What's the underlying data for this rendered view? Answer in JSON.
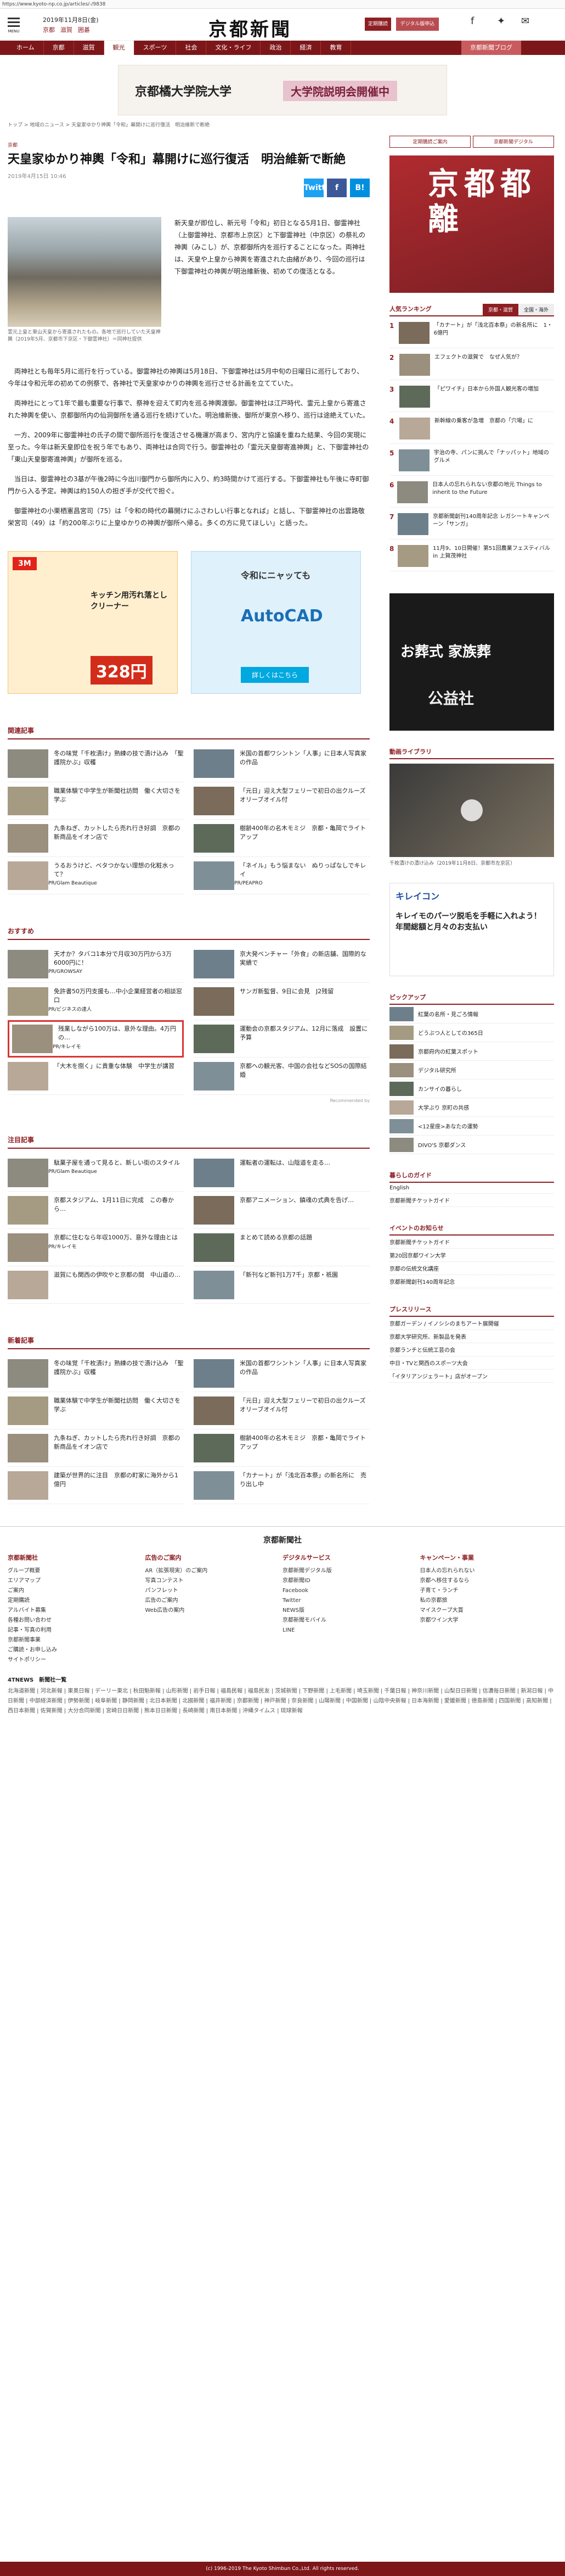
{
  "url": "https://www.kyoto-np.co.jp/articles/-/9838",
  "header": {
    "menu_label": "MENU",
    "date": "2019年11月8日(金)",
    "cats": [
      "京都",
      "滋賀",
      "囲碁"
    ],
    "logo": "京都新聞",
    "btn_signup": "定期購読",
    "btn_edition": "デジタル版申込み",
    "social": [
      "Facebook",
      "Twitter",
      "Line"
    ]
  },
  "nav": [
    "ホーム",
    "京都",
    "滋賀",
    "観光",
    "スポーツ",
    "社会",
    "文化・ライフ",
    "政治",
    "経済",
    "教育",
    "京都新聞ブログ"
  ],
  "banner": {
    "school": "京都橘大学院大学",
    "event": "大学院説明会開催中"
  },
  "breadcrumb": "トップ > 地域のニュース > 天皇家ゆかり神輿「令和」幕開けに巡行復活　明治維新で断絶",
  "article": {
    "section": "京都",
    "title": "天皇家ゆかり神輿「令和」幕開けに巡行復活　明治維新で断絶",
    "date": "2019年4月15日 10:46",
    "share": [
      "Twitter",
      "f",
      "B!"
    ],
    "caption": "霊元上皇と東山天皇から寄進されたもの。各地で巡行していた天皇神輿（2019年5月、京都市下京区・下御霊神社）＝同神社提供",
    "lead": "新天皇が即位し、新元号「令和」初日となる5月1日、御霊神社（上御霊神社、京都市上京区）と下御霊神社（中京区）の祭礼の神輿（みこし）が、京都御所内を巡行することになった。両神社は、天皇や上皇から神輿を寄進された由緒があり、今回の巡行は下御霊神社の神輿が明治維新後、初めての復活となる。",
    "paras": [
      "両神社とも毎年5月に巡行を行っている。御霊神社の神輿は5月18日、下御霊神社は5月中旬の日曜日に巡行しており、今年は令和元年の初めての例祭で、各神社で天皇家ゆかりの神輿を巡行させる計画を立てていた。",
      "両神社にとって1年で最も重要な行事で、祭神を迎えて町内を巡る神輿渡御。御霊神社は江戸時代、霊元上皇から寄進された神輿を使い、京都御所内の仙洞御所を通る巡行を続けていた。明治維新後、御所が東京へ移り、巡行は途絶えていた。",
      "一方、2009年に御霊神社の氏子の間で御所巡行を復活させる機運が高まり、宮内庁と協議を重ねた結果、今回の実現に至った。今年は新天皇即位を祝う年でもあり、両神社は合同で行う。御霊神社の「霊元天皇御寄進神輿」と、下御霊神社の「東山天皇御寄進神輿」が御所を巡る。",
      "当日は、御霊神社の3基が午後2時に今出川御門から御所内に入り、約3時間かけて巡行する。下御霊神社も午後に寺町御門から入る予定。神輿は約150人の担ぎ手が交代で担ぐ。",
      "御霊神社の小栗栖憲昌宮司（75）は「令和の時代の幕開けにふさわしい行事となれば」と話し、下御霊神社の出雲路敬栄宮司（49）は「約200年ぶりに上皇ゆかりの神輿が御所へ帰る。多くの方に見てほしい」と語った。"
    ]
  },
  "ads": {
    "a1_brand": "3M",
    "a1_product": "キッチン用汚れ落としクリーナー",
    "a1_price": "328円",
    "a2_top": "令和にニャッても",
    "a2_big": "AutoCAD",
    "a2_btn": "詳しくはこちら"
  },
  "related": {
    "title": "関連記事",
    "items": [
      {
        "t": "冬の味覚「千枚漬け」熟練の技で漬け込み　「聖護院かぶ」収穫",
        "s": ""
      },
      {
        "t": "米国の首都ワシントン「人事」に日本人写真家の作品",
        "s": ""
      },
      {
        "t": "職業体験で中学生が新聞社訪問　働く大切さを学ぶ",
        "s": ""
      },
      {
        "t": "「元日」迎え大型フェリーで初日の出クルーズ　オリーブオイル付",
        "s": ""
      },
      {
        "t": "九条ねぎ、カットしたら売れ行き好調　京都の新商品をイオン店で",
        "s": ""
      },
      {
        "t": "樹齢400年の名木モミジ　京都・亀岡でライトアップ",
        "s": ""
      },
      {
        "t": "うるおうけど、ベタつかない理想の化粧水って？",
        "s": "PR/Glam Beautique"
      },
      {
        "t": "「ネイル」もう悩まない　ぬりっぱなしでキレイ",
        "s": "PR/PEAPRO"
      }
    ]
  },
  "recommend": {
    "title": "おすすめ",
    "items": [
      {
        "t": "天才か？タバコ1本分で月収30万円から3万6000円に！",
        "s": "PR/GROWSAY"
      },
      {
        "t": "京大発ベンチャー「外食」の新店舗、国際的な実績で",
        "s": ""
      },
      {
        "t": "免許書50万円支援も…中小企業経営者の相談窓口",
        "s": "PR/ビジネスの達人"
      },
      {
        "t": "サンガ新監督、9日に会見　J2残留",
        "s": ""
      },
      {
        "t": "残業しながら100万は、意外な理由。4万円の…",
        "s": "PR/キレイモ"
      },
      {
        "t": "運動会の京都スタジアム、12月に落成　設置に予算",
        "s": ""
      },
      {
        "t": "「大木を捌く」に貴重な体験　中学生が講習",
        "s": ""
      },
      {
        "t": "京都への観光客、中国の会社などSOSの国際結婚",
        "s": ""
      }
    ]
  },
  "recommended_by": "Recommended by",
  "attention": {
    "title": "注目記事",
    "items": [
      {
        "t": "駄菓子屋を通って見ると、新しい街のスタイル",
        "s": "PR/Glam Beautique"
      },
      {
        "t": "運転者の運転は、山陰道を走る…",
        "s": ""
      },
      {
        "t": "京都スタジアム、1月11日に完成　この春から…",
        "s": ""
      },
      {
        "t": "京都アニメーション、鎮魂の式典を告げ…",
        "s": ""
      },
      {
        "t": "京都に住むなら年収1000万、意外な理由とは",
        "s": "PR/キレイモ"
      },
      {
        "t": "まとめて読める京都の話題",
        "s": ""
      },
      {
        "t": "滋賀にも関西の伊吹やと京都の間　中山道の…",
        "s": ""
      },
      {
        "t": "「新刊など新刊1万7千」京都・祇園",
        "s": ""
      }
    ]
  },
  "newest": {
    "title": "新着記事",
    "items": [
      {
        "t": "冬の味覚「千枚漬け」熟練の技で漬け込み　「聖護院かぶ」収穫",
        "s": ""
      },
      {
        "t": "米国の首都ワシントン「人事」に日本人写真家の作品",
        "s": ""
      },
      {
        "t": "職業体験で中学生が新聞社訪問　働く大切さを学ぶ",
        "s": ""
      },
      {
        "t": "「元日」迎え大型フェリーで初日の出クルーズ　オリーブオイル付",
        "s": ""
      },
      {
        "t": "九条ねぎ、カットしたら売れ行き好調　京都の新商品をイオン店で",
        "s": ""
      },
      {
        "t": "樹齢400年の名木モミジ　京都・亀岡でライトアップ",
        "s": ""
      },
      {
        "t": "建築が世界的に注目　京都の町家に海外から1億円",
        "s": ""
      },
      {
        "t": "「カナート」が「浅北百本祭」の新名所に　売り出し中",
        "s": ""
      }
    ]
  },
  "sidebar": {
    "btn1": "定期購読ご案内",
    "btn2": "京都新聞デジタル",
    "ad_title": "京都都離",
    "ranking_title": "人気ランキング",
    "tabs": [
      "京都・滋賀",
      "全国・海外"
    ],
    "ranking": [
      "「カナート」が「浅北百本祭」の新名所に　1・6億円",
      "エフェクトの滋賀で　なぜ人気が？",
      "「ピワイチ」日本から外国人観光客の増加",
      "新幹線の乗客が急増　京都の「穴場」に",
      "宇治の寺、パンに挑んで「ナッパット」地域のグルメ",
      "日本人の忘れられない京都の地元 Things to inherit to the Future",
      "京都新聞創刊140周年記念 レガシートキャンペーン「サンガ」",
      "11月9、10日開催！第51回農業フェスティバル in 上賀茂神社"
    ],
    "ad2_title": "お葬式 家族葬",
    "ad2_sub": "公益社",
    "video_title": "動画ライブラリ",
    "video_caption": "千枚漬けの漬け込み（2019年11月8日、京都市左京区）",
    "ad3_title": "キレイコン",
    "ad3_text": "キレイモのパーツ脱毛を手軽に入れよう！年間総額と月々のお支払い",
    "pickup_title": "ピックアップ",
    "pickup": [
      "紅葉の名所・見ごろ情報",
      "どうぶつ人としての365日",
      "京都府内の紅葉スポット",
      "デジタル研究所",
      "カンサイの暮らし",
      "大学ぶり 京町の共感",
      "<12星座>あなたの運勢",
      "DIVO'S 京都ダンス"
    ],
    "more_title": "暮らしのガイド",
    "more": [
      "English",
      "京都新聞チケットガイド"
    ],
    "events_title": "イベントのお知らせ",
    "events": [
      "京都新聞チケットガイド",
      "第20回京都ワイン大学",
      "京都の伝統文化講座",
      "京都新聞創刊140周年記念"
    ],
    "press_title": "プレスリリース",
    "press": [
      "京都ガーデン / イノシシのまちアート展開催",
      "京都大学研究所、新製品を発表",
      "京都ランチと伝統工芸の会",
      "中日・TVと関西のスポーツ大会",
      "「イタリアンジェラート」店がオープン"
    ]
  },
  "footer": {
    "logo": "京都新聞社",
    "cols": [
      {
        "h": "京都新聞社",
        "items": [
          "グループ概要",
          "エリアマップ",
          "ご案内",
          "定期購読",
          "アルバイト募集",
          "各種お問い合わせ",
          "記事・写真の利用",
          "京都新聞事業",
          "ご購読・お申し込み",
          "サイトポリシー"
        ]
      },
      {
        "h": "広告のご案内",
        "items": [
          "AR（拡張現実）のご案内",
          "写真コンテスト",
          "パンフレット",
          "広告のご案内",
          "Web広告の案内"
        ]
      },
      {
        "h": "デジタルサービス",
        "items": [
          "京都新聞デジタル版",
          "京都新聞ID",
          "Facebook",
          "Twitter",
          "NEWS版",
          "京都新聞モバイル",
          "LINE"
        ]
      },
      {
        "h": "キャンペーン・事業",
        "items": [
          "日本人の忘れられない",
          "京都へ移住するなら",
          "子育て・ランチ",
          "私の京都旅",
          "マイスクープ大賞",
          "京都ワイン大学"
        ]
      }
    ],
    "news4_title": "4TNEWS　新聞社一覧",
    "news4_list": "北海道新聞 | 河北新報 | 東奥日報 | デーリー東北 | 秋田魁新報 | 山形新聞 | 岩手日報 | 福島民報 | 福島民友 | 茨城新聞 | 下野新聞 | 上毛新聞 | 埼玉新聞 | 千葉日報 | 神奈川新聞 | 山梨日日新聞 | 信濃毎日新聞 | 新潟日報 | 中日新聞 | 中部経済新聞 | 伊勢新聞 | 岐阜新聞 | 静岡新聞 | 北日本新聞 | 北國新聞 | 福井新聞 | 京都新聞 | 神戸新聞 | 奈良新聞 | 山陽新聞 | 中国新聞 | 山陰中央新報 | 日本海新聞 | 愛媛新聞 | 徳島新聞 | 四国新聞 | 高知新聞 | 西日本新聞 | 佐賀新聞 | 大分合同新聞 | 宮崎日日新聞 | 熊本日日新聞 | 長崎新聞 | 南日本新聞 | 沖縄タイムス | 琉球新報",
    "copyright": "(c) 1996-2019 The Kyoto Shimbun Co.,Ltd. All rights reserved."
  },
  "colors": {
    "brand": "#7d1619",
    "accent": "#8d1f23"
  }
}
